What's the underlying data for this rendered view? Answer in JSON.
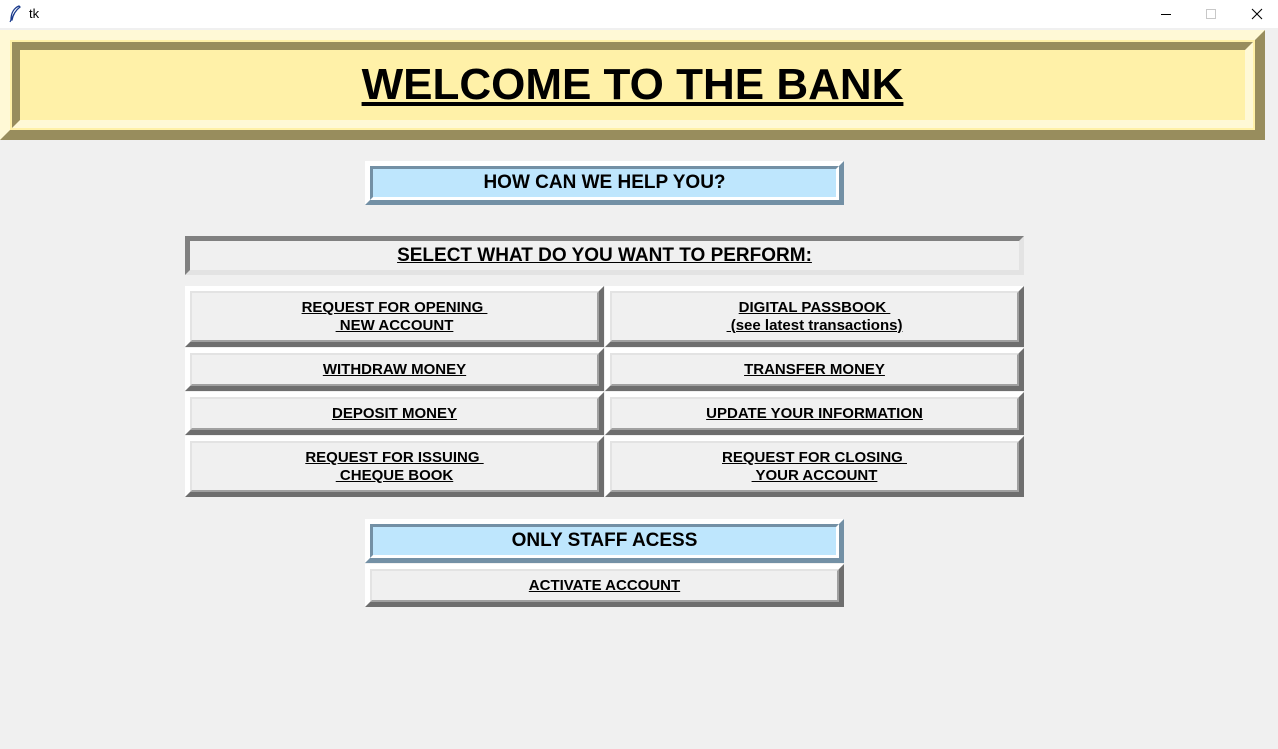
{
  "window": {
    "title": "tk"
  },
  "banner": {
    "title": "WELCOME TO THE BANK"
  },
  "help_heading": "HOW CAN WE HELP YOU?",
  "select_heading": "SELECT WHAT DO YOU WANT TO PERFORM:",
  "buttons": {
    "open_account": "REQUEST FOR OPENING \n NEW ACCOUNT",
    "passbook": "DIGITAL PASSBOOK \n (see latest transactions)",
    "withdraw": "WITHDRAW MONEY",
    "transfer": "TRANSFER MONEY",
    "deposit": "DEPOSIT MONEY",
    "update_info": "UPDATE YOUR INFORMATION",
    "cheque_book": "REQUEST FOR ISSUING \n CHEQUE BOOK",
    "close_account": "REQUEST FOR CLOSING \n YOUR ACCOUNT",
    "activate": "ACTIVATE ACCOUNT"
  },
  "staff_heading": "ONLY STAFF ACESS",
  "icons": {
    "app": "feather-icon",
    "minimize": "minimize-icon",
    "maximize": "maximize-icon",
    "close": "close-icon"
  },
  "colors": {
    "banner_bg": "#fff1a8",
    "heading_bg": "#bee6fd",
    "window_bg": "#f0f0f0"
  }
}
